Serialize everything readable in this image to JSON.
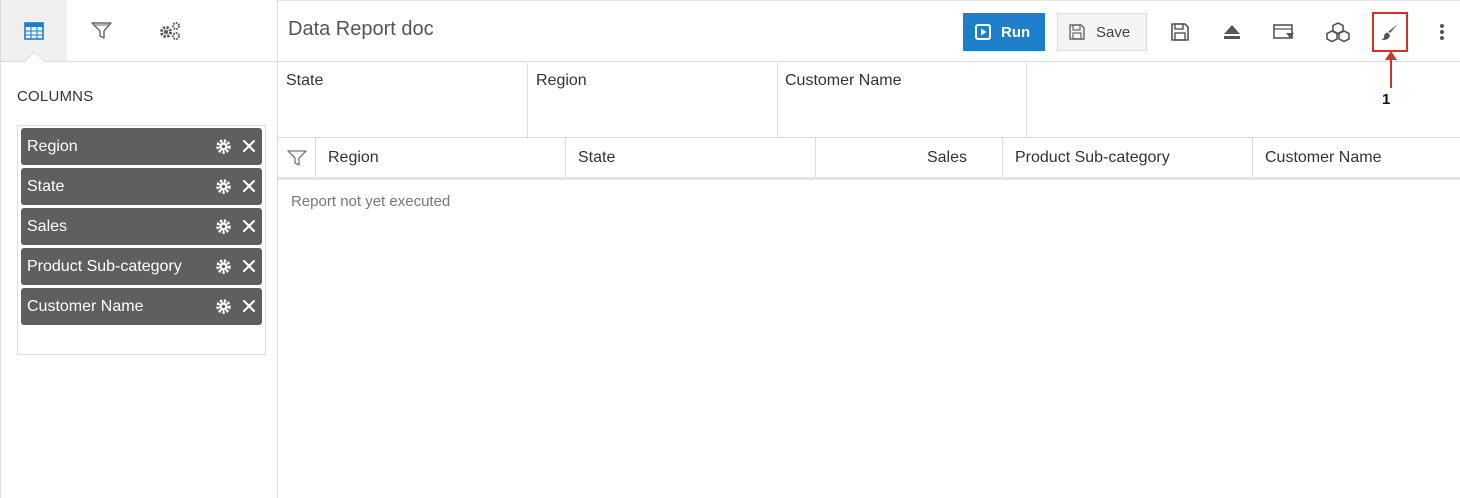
{
  "sidebar": {
    "tabs": [
      {
        "name": "table-icon",
        "active": true
      },
      {
        "name": "filter-icon",
        "active": false
      },
      {
        "name": "gears-icon",
        "active": false
      }
    ],
    "columns_title": "COLUMNS",
    "columns": [
      {
        "label": "Region"
      },
      {
        "label": "State"
      },
      {
        "label": "Sales"
      },
      {
        "label": "Product Sub-category"
      },
      {
        "label": "Customer Name"
      }
    ]
  },
  "header": {
    "title": "Data Report doc",
    "run_label": "Run",
    "save_label": "Save",
    "tools": [
      "save-as-icon",
      "eject-icon",
      "export-icon",
      "cubes-icon",
      "paint-brush-icon",
      "more-vertical-icon"
    ],
    "annotation_number": "1"
  },
  "group_by": [
    "State",
    "Region",
    "Customer Name"
  ],
  "grid": {
    "columns": [
      "Region",
      "State",
      "Sales",
      "Product Sub-category",
      "Customer Name"
    ],
    "empty_message": "Report not yet executed"
  },
  "colors": {
    "accent": "#1d7fc9",
    "pill": "#5f5f5f",
    "highlight": "#d0342c"
  }
}
